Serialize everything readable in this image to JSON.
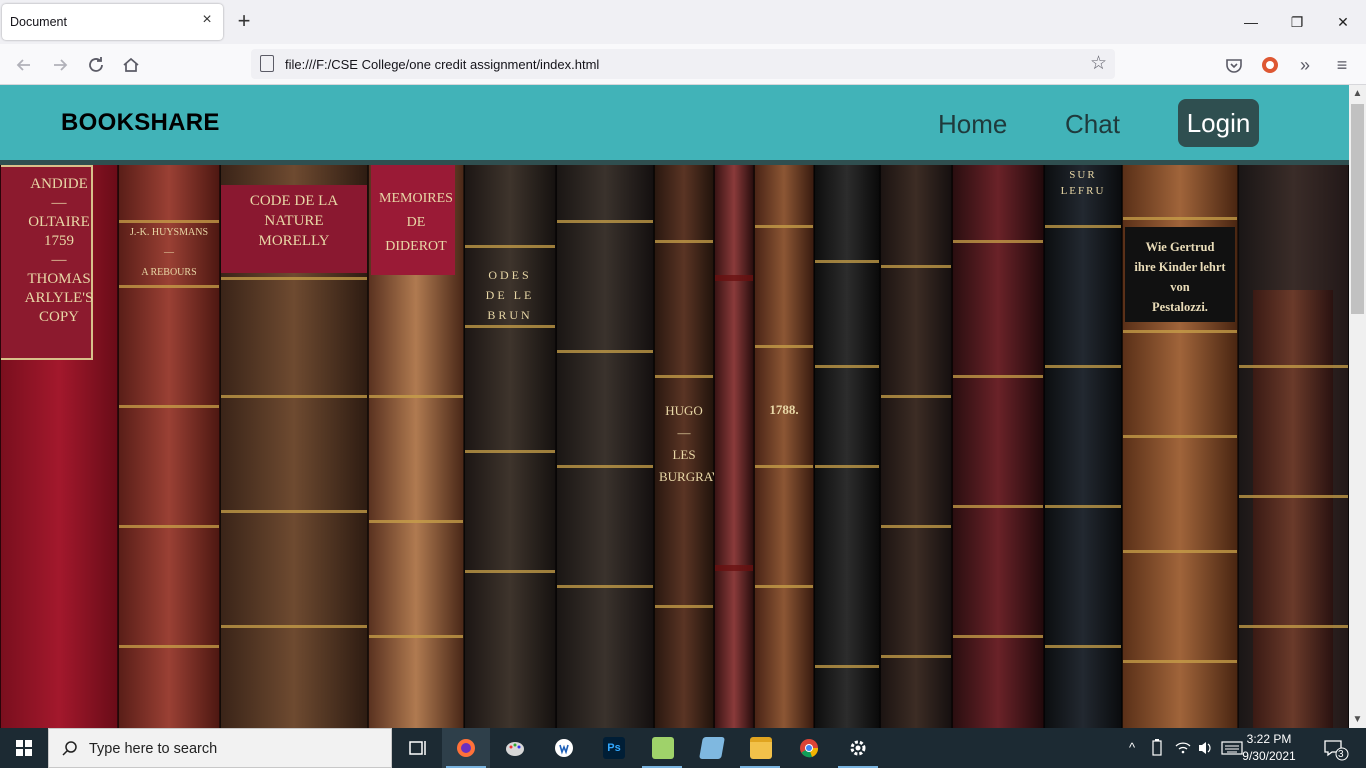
{
  "browser": {
    "tab_title": "Document",
    "tab_close": "×",
    "new_tab": "+",
    "url": "file:///F:/CSE College/one credit assignment/index.html"
  },
  "window": {
    "minimize": "—",
    "restore": "❐",
    "close": "✕"
  },
  "site": {
    "brand": "BOOKSHARE",
    "nav": {
      "home": "Home",
      "chat": "Chat",
      "login": "Login"
    },
    "colors": {
      "header_bg": "#41b3b8",
      "header_border": "#2f4f50",
      "login_bg": "#2f4f50"
    },
    "hero_alt": "Shelf of antique leather-bound books",
    "book_labels": {
      "candide": "ANDIDE\n—\nOLTAIRE\n1759\n—\nTHOMAS\nARLYLE'S\nCOPY",
      "huysmans": "J.-K. HUYSMANS\n—\nA REBOURS",
      "code_nature": "CODE DE LA\nNATURE\nMORELLY",
      "memoires": "MEMOIRES\nDE\nDIDEROT",
      "odes": "ODES\nDE LE\nBRUN",
      "hugo": "HUGO\n—\nLES\nBURGRAV",
      "year": "1788.",
      "pestalozzi": "Wie Gertrud\nihre Kinder lehrt\nvon\nPestalozzi.",
      "sur": "SUR\nLEFRU"
    }
  },
  "taskbar": {
    "search_placeholder": "Type here to search",
    "time": "3:22 PM",
    "date": "9/30/2021",
    "notifications": "3"
  }
}
